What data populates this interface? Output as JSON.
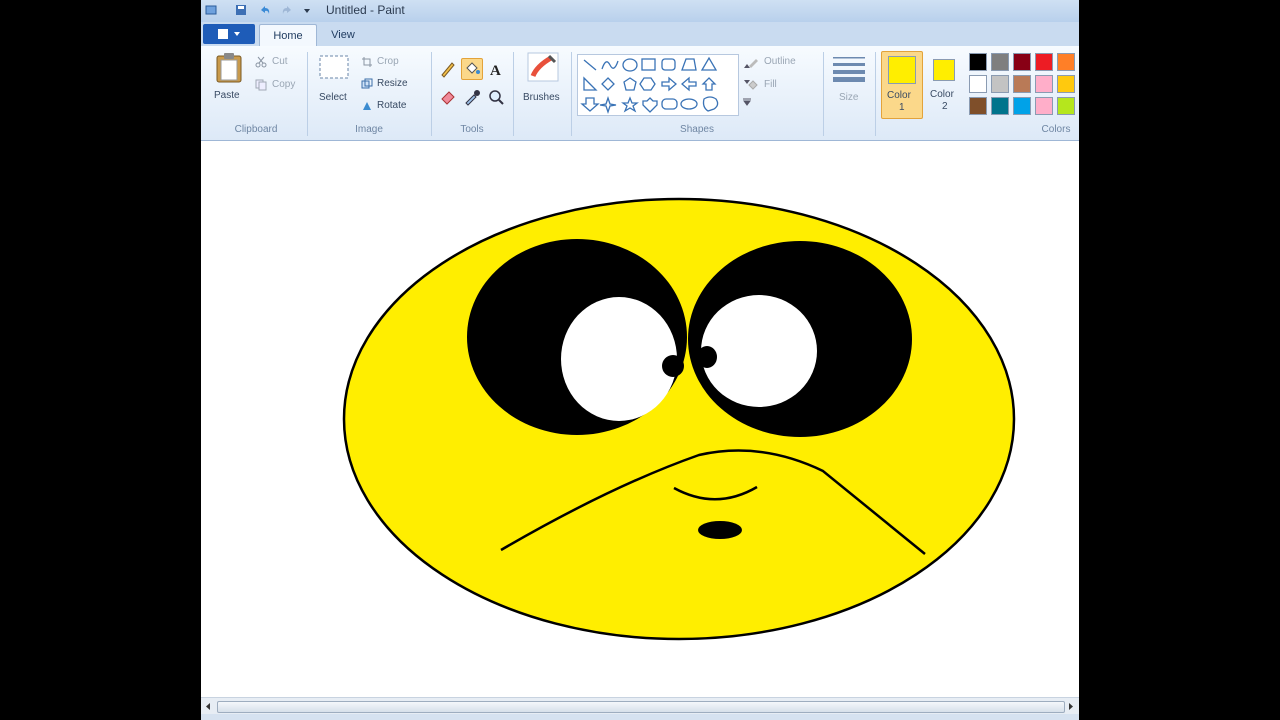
{
  "window": {
    "title": "Untitled - Paint"
  },
  "tabs": {
    "file": "",
    "home": "Home",
    "view": "View"
  },
  "clipboard": {
    "paste": "Paste",
    "cut": "Cut",
    "copy": "Copy",
    "label": "Clipboard"
  },
  "image": {
    "select": "Select",
    "crop": "Crop",
    "resize": "Resize",
    "rotate": "Rotate",
    "label": "Image"
  },
  "tools": {
    "label": "Tools"
  },
  "brushes": {
    "label": "Brushes"
  },
  "shapes": {
    "outline": "Outline",
    "fill": "Fill",
    "label": "Shapes"
  },
  "size": {
    "label": "Size"
  },
  "colors": {
    "color1": "Color",
    "color1_num": "1",
    "color2": "Color",
    "color2_num": "2",
    "label": "Colors",
    "color1_value": "#ffee00",
    "color2_value": "#ffee00",
    "palette": [
      "#000000",
      "#7f7f7f",
      "#880015",
      "#ed1c24",
      "#ff7f27",
      "#ffffff",
      "#c3c3c3",
      "#b97a57",
      "#ffaec9",
      "#ffc90e",
      "#7f4f2a",
      "#00748c",
      "#00a2e8",
      "#ffaec9",
      "#b5e61d"
    ]
  },
  "drawing": {
    "face_color": "#ffee00",
    "stroke": "#000000"
  }
}
